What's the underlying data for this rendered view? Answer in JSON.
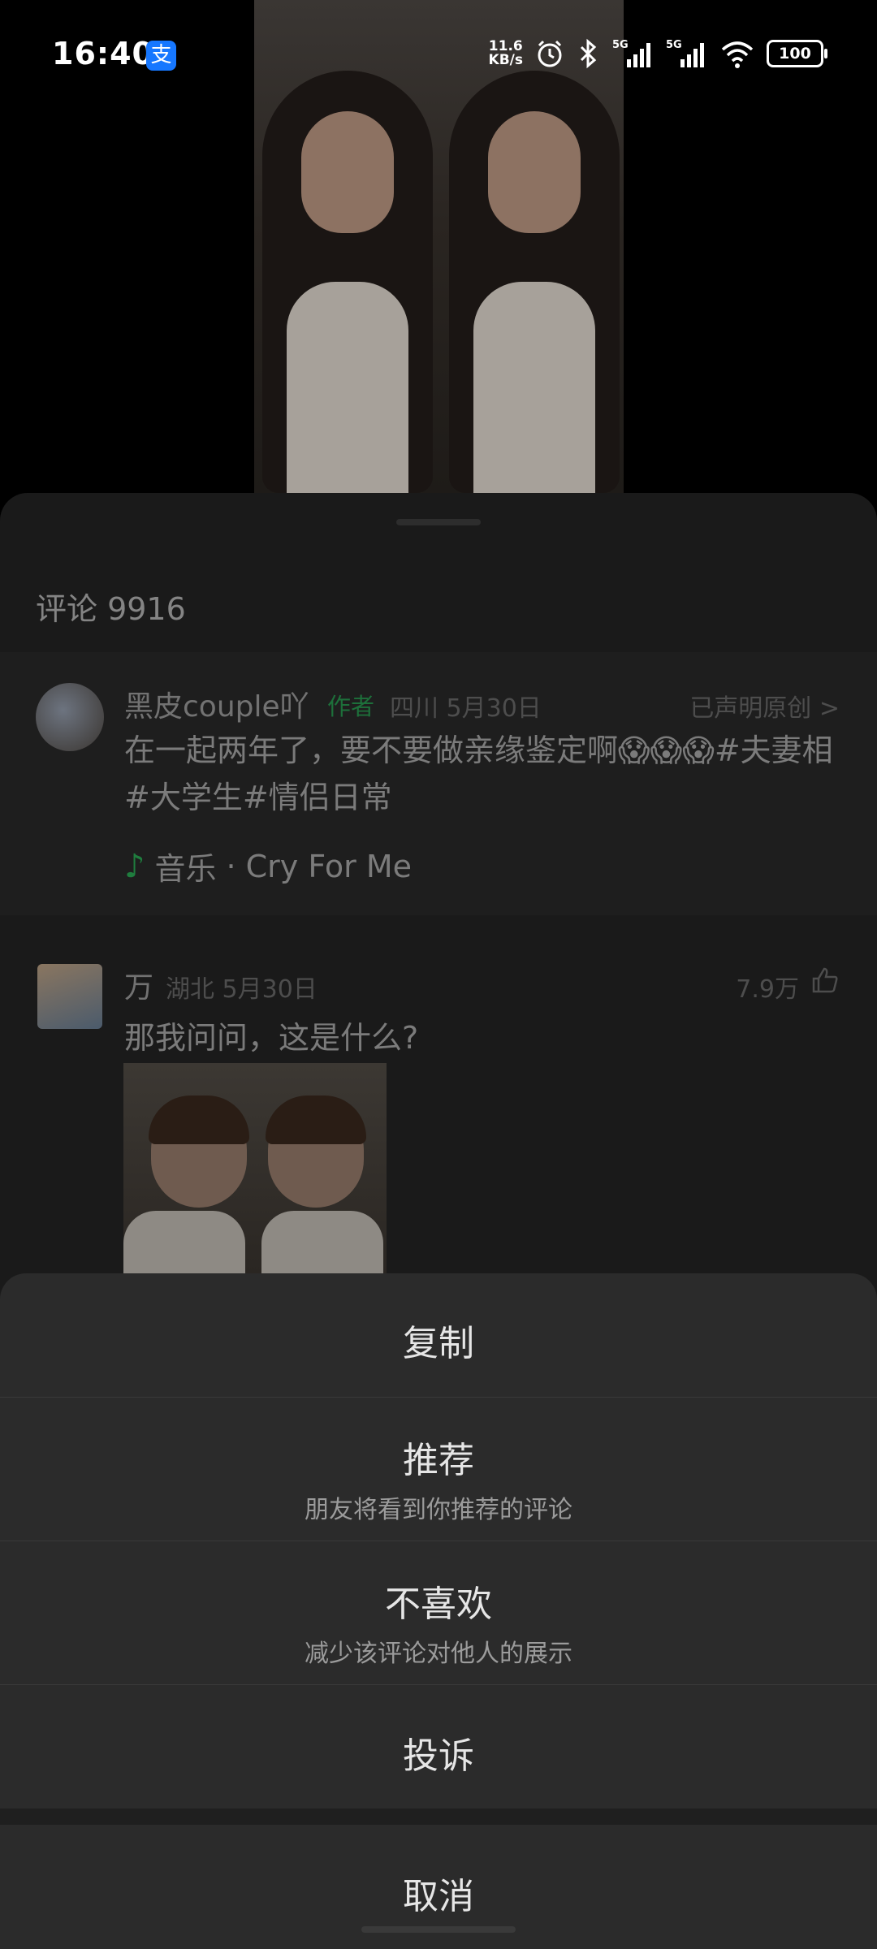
{
  "status_bar": {
    "time": "16:40",
    "app_badge": "支",
    "net_speed_value": "11.6",
    "net_speed_unit": "KB/s",
    "signal_1": "5G",
    "signal_2": "5G",
    "battery": "100"
  },
  "comments": {
    "title": "评论 9916",
    "author_post": {
      "author": "黑皮couple吖",
      "author_tag": "作者",
      "location_date": "四川 5月30日",
      "original_link": "已声明原创 >",
      "text": "在一起两年了，要不要做亲缘鉴定啊😱😱😱#夫妻相#大学生#情侣日常",
      "music_prefix": "音乐",
      "music_title": "Cry For Me"
    },
    "items": [
      {
        "author": "万",
        "location_date": "湖北 5月30日",
        "likes": "7.9万",
        "text": "那我问问，这是什么?"
      }
    ]
  },
  "action_sheet": {
    "copy": "复制",
    "recommend": "推荐",
    "recommend_desc": "朋友将看到你推荐的评论",
    "dislike": "不喜欢",
    "dislike_desc": "减少该评论对他人的展示",
    "report": "投诉",
    "cancel": "取消"
  }
}
